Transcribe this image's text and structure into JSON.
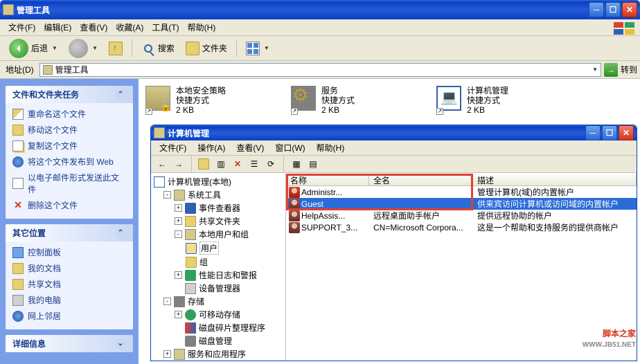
{
  "outer": {
    "title": "管理工具",
    "menu": {
      "file": "文件(F)",
      "edit": "编辑(E)",
      "view": "查看(V)",
      "fav": "收藏(A)",
      "tools": "工具(T)",
      "help": "帮助(H)"
    },
    "toolbar": {
      "back": "后退",
      "search": "搜索",
      "folders": "文件夹"
    },
    "address": {
      "label": "地址(D)",
      "value": "管理工具",
      "go": "转到"
    }
  },
  "sidebar": {
    "tasks": {
      "title": "文件和文件夹任务",
      "rename": "重命名这个文件",
      "move": "移动这个文件",
      "copy": "复制这个文件",
      "web": "将这个文件发布到 Web",
      "mail": "以电子邮件形式发送此文件",
      "del": "删除这个文件"
    },
    "places": {
      "title": "其它位置",
      "cp": "控制面板",
      "docs": "我的文档",
      "share": "共享文档",
      "comp": "我的电脑",
      "net": "网上邻居"
    },
    "details": {
      "title": "详细信息"
    }
  },
  "icons": {
    "secpol": {
      "name": "本地安全策略",
      "type": "快捷方式",
      "size": "2 KB"
    },
    "svc": {
      "name": "服务",
      "type": "快捷方式",
      "size": "2 KB"
    },
    "cmgmt": {
      "name": "计算机管理",
      "type": "快捷方式",
      "size": "2 KB"
    }
  },
  "inner": {
    "title": "计算机管理",
    "menu": {
      "file": "文件(F)",
      "action": "操作(A)",
      "view": "查看(V)",
      "window": "窗口(W)",
      "help": "帮助(H)"
    },
    "tree": {
      "root": "计算机管理(本地)",
      "sys": "系统工具",
      "ev": "事件查看器",
      "sf": "共享文件夹",
      "lug": "本地用户和组",
      "users": "用户",
      "groups": "组",
      "perf": "性能日志和警报",
      "dev": "设备管理器",
      "stor": "存储",
      "rem": "可移动存储",
      "defrag": "磁盘碎片整理程序",
      "disk": "磁盘管理",
      "svcapp": "服务和应用程序"
    },
    "list": {
      "cols": {
        "name": "名称",
        "full": "全名",
        "desc": "描述"
      },
      "rows": [
        {
          "name": "Administr...",
          "full": "",
          "desc": "管理计算机(域)的内置帐户"
        },
        {
          "name": "Guest",
          "full": "",
          "desc": "供来宾访问计算机或访问域的内置帐户"
        },
        {
          "name": "HelpAssis...",
          "full": "远程桌面助手帐户",
          "desc": "提供远程协助的帐户"
        },
        {
          "name": "SUPPORT_3...",
          "full": "CN=Microsoft Corpora...",
          "desc": "这是一个帮助和支持服务的提供商帐户"
        }
      ]
    }
  },
  "watermark": {
    "line1": "脚本之家",
    "line2": "WWW.JB51.NET"
  }
}
